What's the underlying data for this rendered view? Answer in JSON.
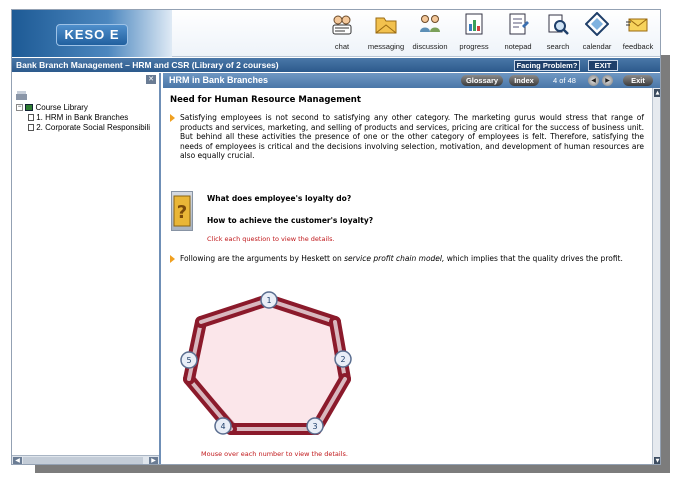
{
  "brand": {
    "logo_text": "KESO E"
  },
  "toolbar": [
    {
      "label": "chat",
      "icon": "chat-icon"
    },
    {
      "label": "messaging",
      "icon": "messaging-icon"
    },
    {
      "label": "discussion",
      "icon": "discussion-icon"
    },
    {
      "label": "progress",
      "icon": "progress-icon"
    },
    {
      "label": "notepad",
      "icon": "notepad-icon"
    },
    {
      "label": "search",
      "icon": "search-icon"
    },
    {
      "label": "calendar",
      "icon": "calendar-icon"
    },
    {
      "label": "feedback",
      "icon": "feedback-icon"
    }
  ],
  "course_bar": {
    "title": "Bank Branch Management – HRM and CSR (Library of 2 courses)",
    "facing_problem": "Facing Problem?",
    "exit": "EXIT"
  },
  "tree": {
    "root": "Course Library",
    "items": [
      "1. HRM in Bank Branches",
      "2. Corporate Social Responsibili"
    ]
  },
  "module": {
    "title": "HRM in Bank Branches",
    "glossary": "Glossary",
    "index": "Index",
    "page_count": "4 of 48",
    "exit": "Exit"
  },
  "content": {
    "heading": "Need for Human Resource Management",
    "paragraph1": "Satisfying employees is not second to satisfying any other category. The marketing gurus would stress that range of products and services, marketing, and selling of products and services, pricing are critical for the success of business unit. But behind all these activities the presence of one or the other category of employees is felt. Therefore, satisfying the needs of employees is critical and the decisions involving selection, motivation, and development of human resources are also equally crucial.",
    "question1": "What does employee's loyalty do?",
    "question2": "How to achieve the customer's loyalty?",
    "click_hint": "Click each question to view the details.",
    "paragraph2_before": "Following are the arguments by Heskett on ",
    "paragraph2_italic": "service profit chain model,",
    "paragraph2_after": " which implies that the quality drives the profit.",
    "chain_numbers": [
      "1",
      "2",
      "3",
      "4",
      "5"
    ],
    "mouse_hint": "Mouse over each number to view the details."
  },
  "colors": {
    "title_bar": "#2c5a8c",
    "chain_link": "#8b1a2b",
    "hint_red": "#c0171a",
    "bullet": "#f0a020"
  }
}
